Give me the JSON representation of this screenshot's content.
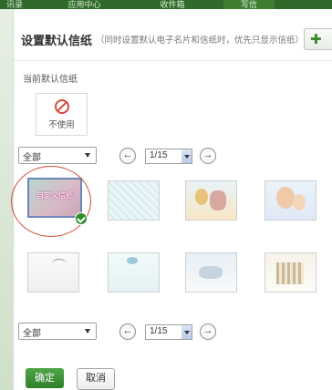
{
  "tabs": [
    "讯录",
    "应用中心",
    "收件箱",
    "写信"
  ],
  "dialog": {
    "title": "设置默认信纸",
    "note": "（同时设置默认电子名片和信纸时，优先只显示信纸）",
    "current_label": "当前默认信纸",
    "current_value": "不使用"
  },
  "filter": {
    "selected": "全部"
  },
  "pager": {
    "page": "1/15"
  },
  "thumbnails": [
    {
      "label": "自定义信纸",
      "selected": true
    },
    {
      "label": "",
      "selected": false
    },
    {
      "label": "",
      "selected": false
    },
    {
      "label": "",
      "selected": false
    },
    {
      "label": "",
      "selected": false
    },
    {
      "label": "",
      "selected": false
    },
    {
      "label": "",
      "selected": false
    },
    {
      "label": "",
      "selected": false
    }
  ],
  "buttons": {
    "ok": "确定",
    "cancel": "取消"
  },
  "icons": [
    "plus-icon",
    "no-entry-icon",
    "prev-page-icon",
    "next-page-icon",
    "checkmark-icon",
    "chevron-down-icon"
  ],
  "colors": {
    "accent": "#2f7f2a",
    "ring": "#d24c3a",
    "header": "#2f6a2a"
  }
}
